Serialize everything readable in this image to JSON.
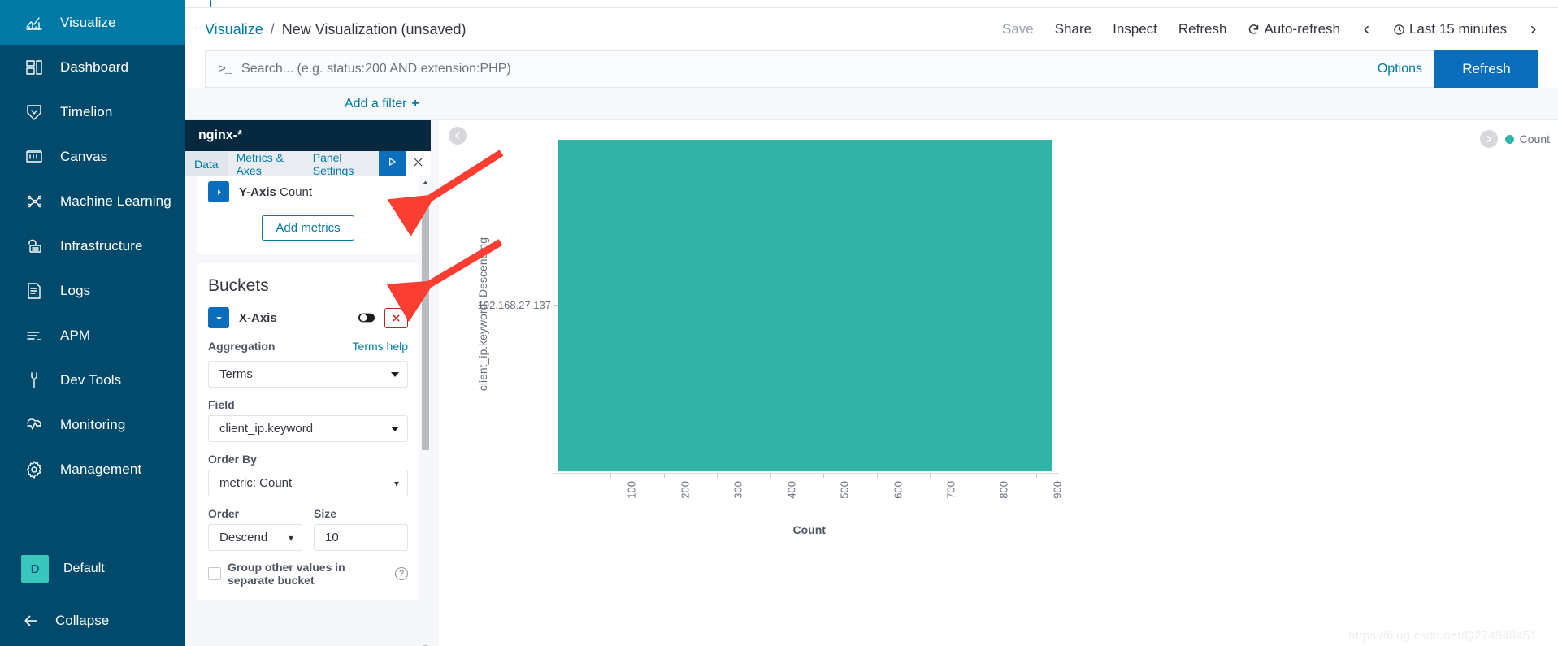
{
  "sidebar": {
    "items": [
      {
        "label": "Visualize",
        "icon": "visualize-icon",
        "active": true
      },
      {
        "label": "Dashboard",
        "icon": "dashboard-icon",
        "active": false
      },
      {
        "label": "Timelion",
        "icon": "timelion-icon",
        "active": false
      },
      {
        "label": "Canvas",
        "icon": "canvas-icon",
        "active": false
      },
      {
        "label": "Machine Learning",
        "icon": "machine-learning-icon",
        "active": false
      },
      {
        "label": "Infrastructure",
        "icon": "infrastructure-icon",
        "active": false
      },
      {
        "label": "Logs",
        "icon": "logs-icon",
        "active": false
      },
      {
        "label": "APM",
        "icon": "apm-icon",
        "active": false
      },
      {
        "label": "Dev Tools",
        "icon": "dev-tools-icon",
        "active": false
      },
      {
        "label": "Monitoring",
        "icon": "monitoring-icon",
        "active": false
      },
      {
        "label": "Management",
        "icon": "management-icon",
        "active": false
      }
    ],
    "space": {
      "badge": "D",
      "label": "Default"
    },
    "collapse": {
      "label": "Collapse",
      "icon": "arrow-left-icon"
    },
    "colors": {
      "background": "#014a6b",
      "active": "#0079a5",
      "badge": "#39c7bd"
    }
  },
  "breadcrumb": {
    "root": "Visualize",
    "separator": "/",
    "current": "New Visualization (unsaved)"
  },
  "top_actions": {
    "save": "Save",
    "share": "Share",
    "inspect": "Inspect",
    "refresh": "Refresh",
    "auto_refresh": "Auto-refresh",
    "time_range": "Last 15 minutes",
    "prev_icon": "chevron-left-icon",
    "next_icon": "chevron-right-icon",
    "clock_icon": "clock-icon",
    "autorefresh_icon": "refresh-cycle-icon"
  },
  "search": {
    "prompt": ">_",
    "value": "",
    "placeholder": "Search... (e.g. status:200 AND extension:PHP)",
    "options_label": "Options",
    "refresh_label": "Refresh"
  },
  "filter_bar": {
    "label": "Add a filter",
    "plus": "+"
  },
  "editor": {
    "index_pattern": "nginx-*",
    "tabs": [
      {
        "label": "Data",
        "active": true
      },
      {
        "label": "Metrics & Axes",
        "active": false
      },
      {
        "label": "Panel Settings",
        "active": false
      }
    ],
    "apply_icon": "play-icon",
    "close_icon": "close-icon",
    "metrics": {
      "y_axis_label": "Y-Axis",
      "y_axis_value": "Count",
      "add_metrics_label": "Add metrics",
      "expand_icon": "caret-right-icon"
    },
    "buckets": {
      "title": "Buckets",
      "x_axis_label": "X-Axis",
      "collapse_icon": "caret-down-icon",
      "toggle_icon": "toggle-icon",
      "remove_icon": "remove-x-icon",
      "aggregation": {
        "label": "Aggregation",
        "help_label": "Terms help",
        "value": "Terms"
      },
      "field": {
        "label": "Field",
        "value": "client_ip.keyword"
      },
      "order_by": {
        "label": "Order By",
        "value": "metric: Count"
      },
      "order": {
        "label": "Order",
        "value": "Descend"
      },
      "size": {
        "label": "Size",
        "value": "10"
      },
      "group_other": {
        "label": "Group other values in separate bucket",
        "checked": false,
        "help_icon": "question-icon"
      }
    },
    "scrollbar": {
      "up_icon": "caret-up-icon",
      "down_icon": "caret-down-icon"
    }
  },
  "visualization": {
    "collapse_icon": "circle-chevron-left-icon",
    "legend_toggle_icon": "circle-chevron-right-icon",
    "watermark": "https://blog.csdn.net/Q274948451"
  },
  "chart_data": {
    "type": "bar",
    "orientation": "horizontal",
    "title": "",
    "categories": [
      "192.168.27.137"
    ],
    "values": [
      930
    ],
    "series": [
      {
        "name": "Count",
        "color": "#32b3a8",
        "values": [
          930
        ]
      }
    ],
    "xlabel": "Count",
    "ylabel": "client_ip.keyword: Descending",
    "xticks": [
      100,
      200,
      300,
      400,
      500,
      600,
      700,
      800,
      900
    ],
    "xlim": [
      0,
      940
    ],
    "grid": false,
    "legend": {
      "position": "top-right",
      "entries": [
        {
          "label": "Count",
          "color": "#32b3a8"
        }
      ]
    }
  }
}
